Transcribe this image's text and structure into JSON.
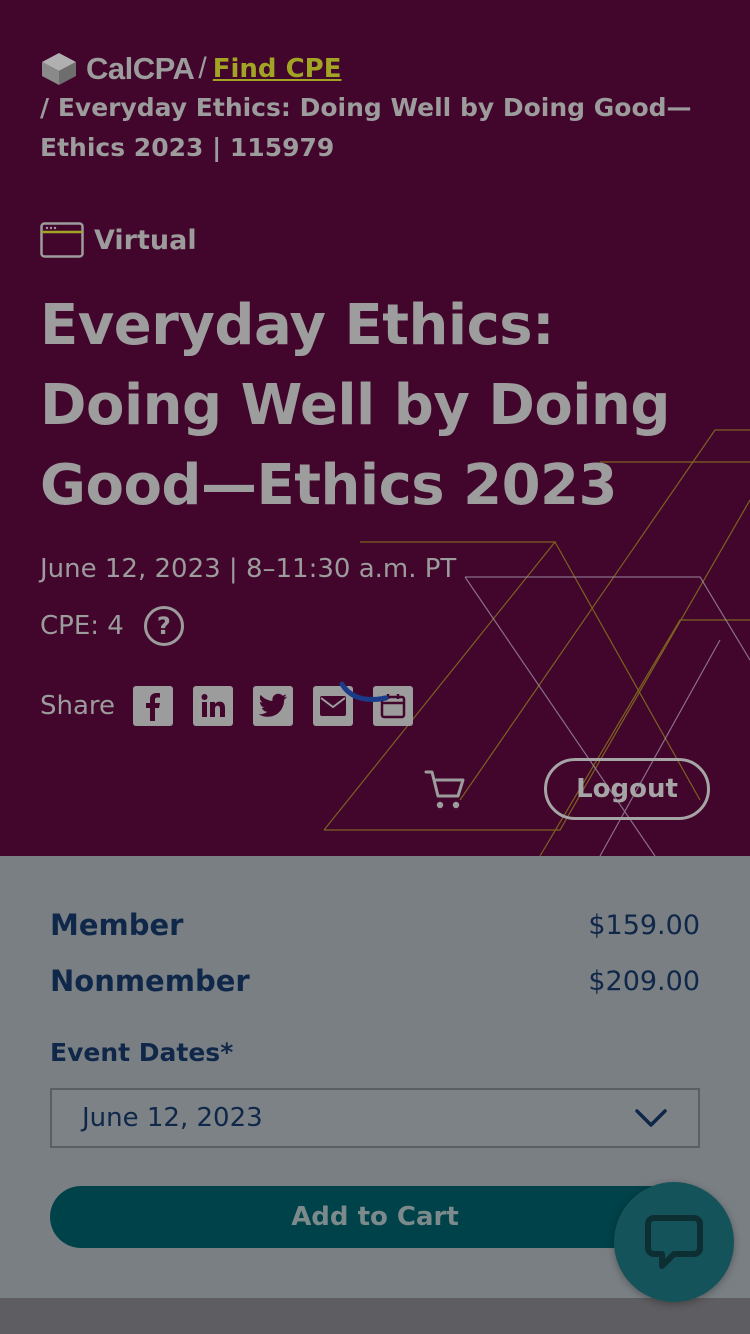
{
  "breadcrumb": {
    "brand": "CalCPA",
    "separator": "/",
    "link_label": "Find CPE",
    "current": "/ Everyday Ethics: Doing Well by Doing Good— Ethics 2023 | 115979"
  },
  "event": {
    "format_icon": "browser-window-icon",
    "format_label": "Virtual",
    "title": "Everyday Ethics: Doing Well by Doing Good—Ethics 2023",
    "date_line": "June 12, 2023 | 8–11:30 a.m. PT",
    "cpe_label": "CPE: 4",
    "help_symbol": "?"
  },
  "share": {
    "label": "Share",
    "buttons": [
      {
        "icon": "facebook-icon",
        "glyph": "f"
      },
      {
        "icon": "linkedin-icon",
        "glyph": "in"
      },
      {
        "icon": "twitter-icon",
        "glyph": ""
      },
      {
        "icon": "email-icon",
        "glyph": ""
      },
      {
        "icon": "calendar-icon",
        "glyph": ""
      }
    ]
  },
  "header_actions": {
    "cart_icon": "cart-icon",
    "logout_label": "Logout"
  },
  "pricing": {
    "member_label": "Member",
    "member_price": "$159.00",
    "nonmember_label": "Nonmember",
    "nonmember_price": "$209.00"
  },
  "event_dates": {
    "label": "Event Dates*",
    "selected": "June 12, 2023"
  },
  "cart": {
    "add_label": "Add to Cart"
  },
  "chat": {
    "icon": "chat-bubble-icon"
  },
  "colors": {
    "hero_bg": "#42052c",
    "accent_link": "#a2a524",
    "primary_button": "#004249",
    "text_dark": "#0f2748"
  }
}
